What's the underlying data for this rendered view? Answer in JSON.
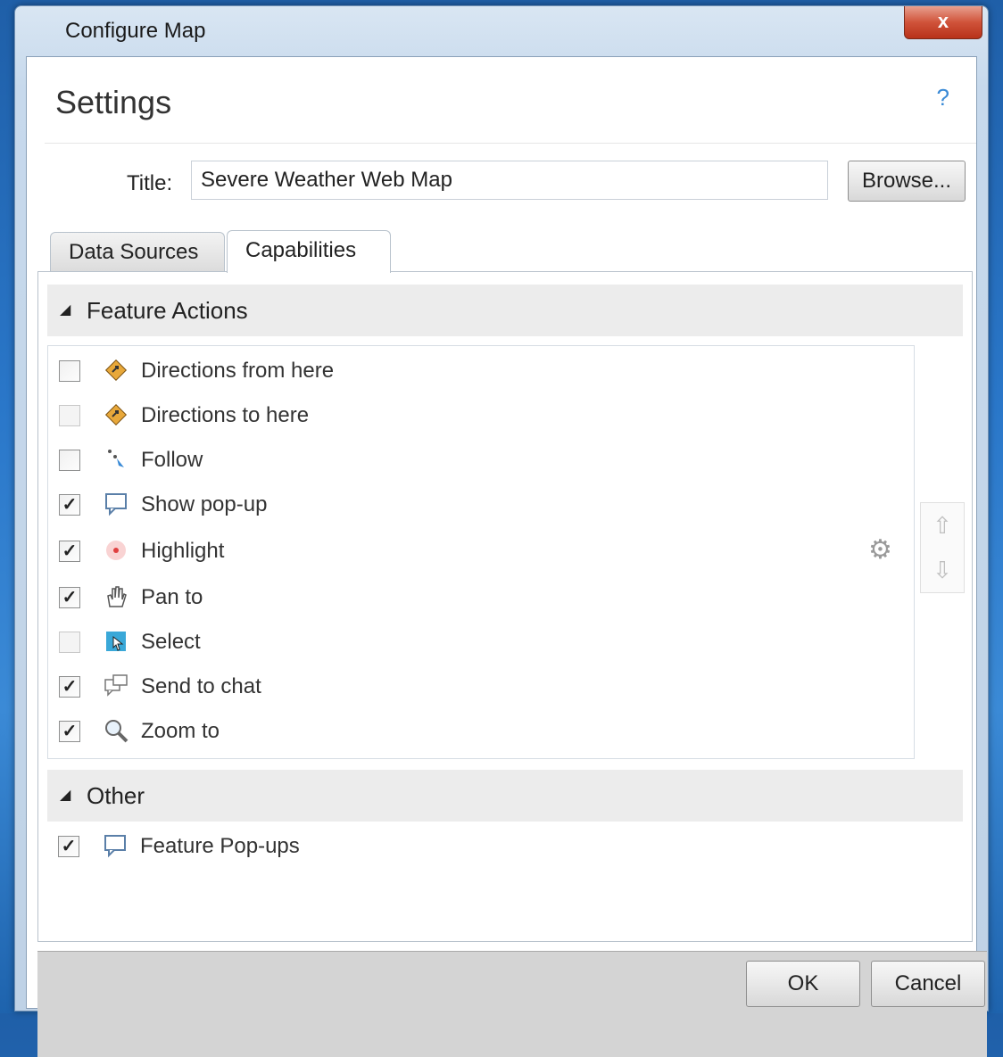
{
  "window": {
    "title": "Configure Map",
    "close_label": "x"
  },
  "header": {
    "heading": "Settings",
    "help": "?"
  },
  "form": {
    "title_label": "Title:",
    "title_value": "Severe Weather Web Map",
    "browse_label": "Browse..."
  },
  "tabs": [
    {
      "label": "Data Sources",
      "active": false
    },
    {
      "label": "Capabilities",
      "active": true
    }
  ],
  "feature_actions": {
    "header": "Feature Actions",
    "items": [
      {
        "label": "Directions from here",
        "checked": false,
        "enabled": true,
        "icon": "directions-icon"
      },
      {
        "label": "Directions to here",
        "checked": false,
        "enabled": false,
        "icon": "directions-icon"
      },
      {
        "label": "Follow",
        "checked": false,
        "enabled": true,
        "icon": "follow-icon"
      },
      {
        "label": "Show pop-up",
        "checked": true,
        "enabled": true,
        "icon": "popup-icon"
      },
      {
        "label": "Highlight",
        "checked": true,
        "enabled": true,
        "icon": "highlight-icon"
      },
      {
        "label": "Pan to",
        "checked": true,
        "enabled": true,
        "icon": "hand-icon"
      },
      {
        "label": "Select",
        "checked": false,
        "enabled": false,
        "icon": "select-icon"
      },
      {
        "label": "Send to chat",
        "checked": true,
        "enabled": true,
        "icon": "chat-icon"
      },
      {
        "label": "Zoom to",
        "checked": true,
        "enabled": true,
        "icon": "zoom-icon"
      }
    ]
  },
  "other": {
    "header": "Other",
    "items": [
      {
        "label": "Feature Pop-ups",
        "checked": true,
        "icon": "popup-icon"
      }
    ]
  },
  "side_controls": {
    "gear_icon": "gear-icon",
    "up_icon": "arrow-up-icon",
    "down_icon": "arrow-down-icon"
  },
  "footer": {
    "ok_label": "OK",
    "cancel_label": "Cancel"
  }
}
